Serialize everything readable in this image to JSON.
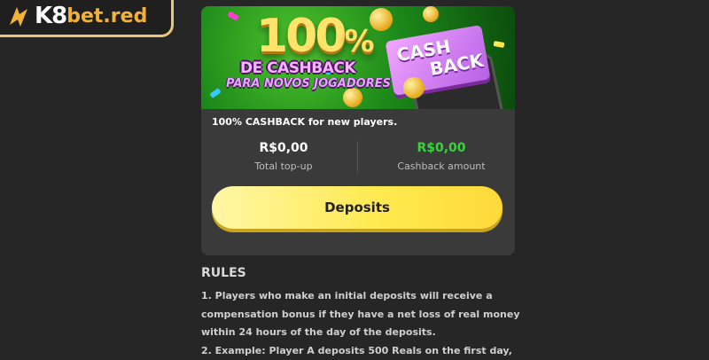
{
  "logo": {
    "brand_k8": "K8",
    "brand_rest": "bet.red"
  },
  "banner": {
    "headline_number": "100",
    "headline_percent": "%",
    "subtitle_1": "DE CASHBACK",
    "subtitle_2": "PARA NOVOS JOGADORES",
    "tag_line_1": "CASH",
    "tag_line_2": "BACK"
  },
  "promo": {
    "description": "100% CASHBACK for new players."
  },
  "stats": {
    "total_topup_value": "R$0,00",
    "total_topup_label": "Total top-up",
    "cashback_value": "R$0,00",
    "cashback_label": "Cashback amount"
  },
  "actions": {
    "deposit_label": "Deposits"
  },
  "rules": {
    "title": "RULES",
    "lines": [
      "1. Players who make an initial deposits will receive a",
      "compensation bonus if they have a net loss of real money",
      "within 24 hours of the day of the deposits.",
      "2. Example: Player A deposits 500 Reals on the first day,"
    ]
  },
  "colors": {
    "accent_yellow": "#ffe94d",
    "positive_green": "#37d43a",
    "logo_gold": "#f2b23a"
  }
}
